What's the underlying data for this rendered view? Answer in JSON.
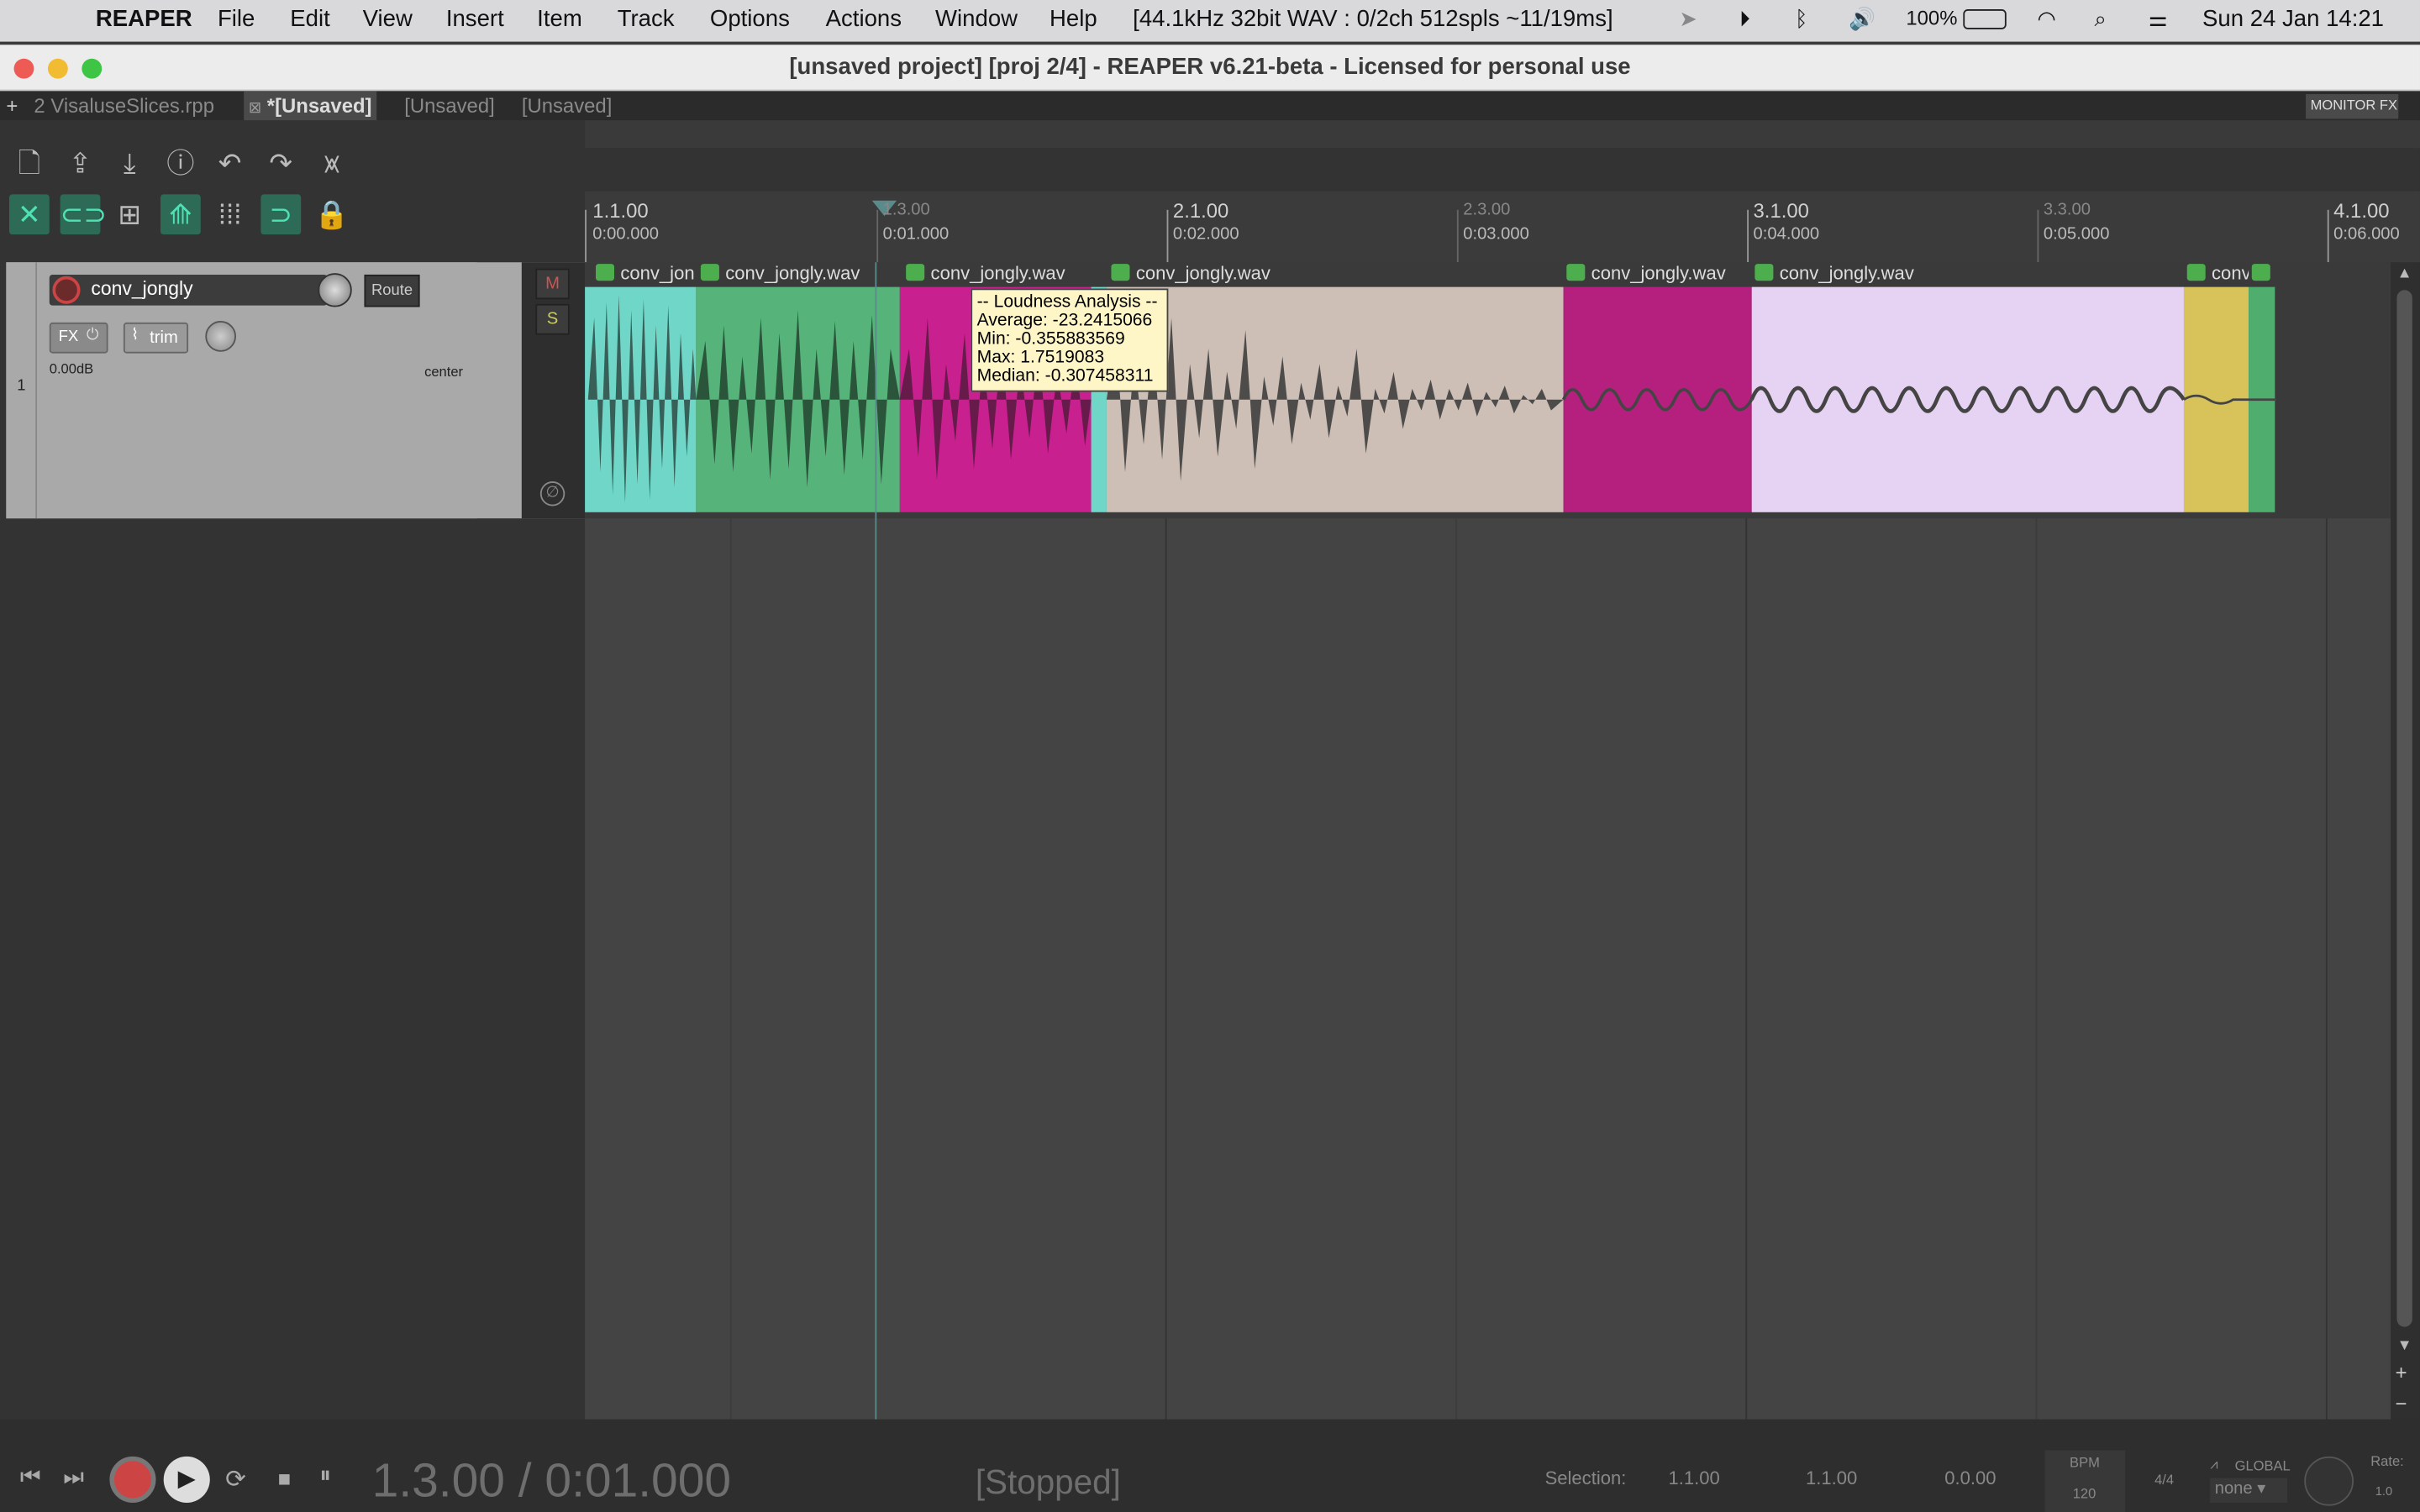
{
  "menubar": {
    "items": [
      "REAPER",
      "File",
      "Edit",
      "View",
      "Insert",
      "Item",
      "Track",
      "Options",
      "Actions",
      "Window",
      "Help"
    ],
    "audio_status": "[44.1kHz 32bit WAV : 0/2ch 512spls ~11/19ms]",
    "battery": "100%",
    "clock": "Sun 24 Jan  14:21"
  },
  "window": {
    "title": "[unsaved project] [proj 2/4] - REAPER v6.21-beta - Licensed for personal use"
  },
  "tabs": [
    {
      "label": "2  VisaluseSlices.rpp"
    },
    {
      "label": "*[Unsaved]"
    },
    {
      "label": "[Unsaved]"
    },
    {
      "label": "[Unsaved]"
    }
  ],
  "monitor_fx": "MONITOR FX",
  "track": {
    "number": "1",
    "name": "conv_jongly",
    "route": "Route",
    "fx": "FX",
    "trim": "trim",
    "volume": "0.00dB",
    "pan": "center",
    "mute": "M",
    "solo": "S"
  },
  "ruler": {
    "bars": [
      {
        "bar": "1.1.00",
        "time": "0:00.000"
      },
      {
        "bar": "1.3.00",
        "time": "0:01.000"
      },
      {
        "bar": "2.1.00",
        "time": "0:02.000"
      },
      {
        "bar": "2.3.00",
        "time": "0:03.000"
      },
      {
        "bar": "3.1.00",
        "time": "0:04.000"
      },
      {
        "bar": "3.3.00",
        "time": "0:05.000"
      },
      {
        "bar": "4.1.00",
        "time": "0:06.000"
      }
    ]
  },
  "items": [
    {
      "label": "conv_jon",
      "color": "#6fd6c8"
    },
    {
      "label": "conv_jongly.wav",
      "color": "#56b37a"
    },
    {
      "label": "conv_jongly.wav",
      "color": "#c8208e"
    },
    {
      "label": "conv_jongly.wav",
      "color": "#cdbfb5"
    },
    {
      "label": "conv_jongly.wav",
      "color": "#b5207f"
    },
    {
      "label": "conv_jongly.wav",
      "color": "#e6d2f2"
    },
    {
      "label": "conv",
      "color": "#d8c25a"
    }
  ],
  "tooltip": {
    "title": "-- Loudness Analysis --",
    "average": "Average: -23.2415066",
    "min": "Min: -0.355883569",
    "max": "Max: 1.7519083",
    "median": "Median: -0.307458311"
  },
  "transport": {
    "position": "1.3.00 / 0:01.000",
    "state": "[Stopped]",
    "selection_label": "Selection:",
    "sel_start": "1.1.00",
    "sel_end": "1.1.00",
    "sel_len": "0.0.00",
    "bpm_label": "BPM",
    "bpm": "120",
    "timesig": "4/4",
    "global": "GLOBAL",
    "global_val": "none",
    "rate_label": "Rate:",
    "rate": "1.0"
  }
}
